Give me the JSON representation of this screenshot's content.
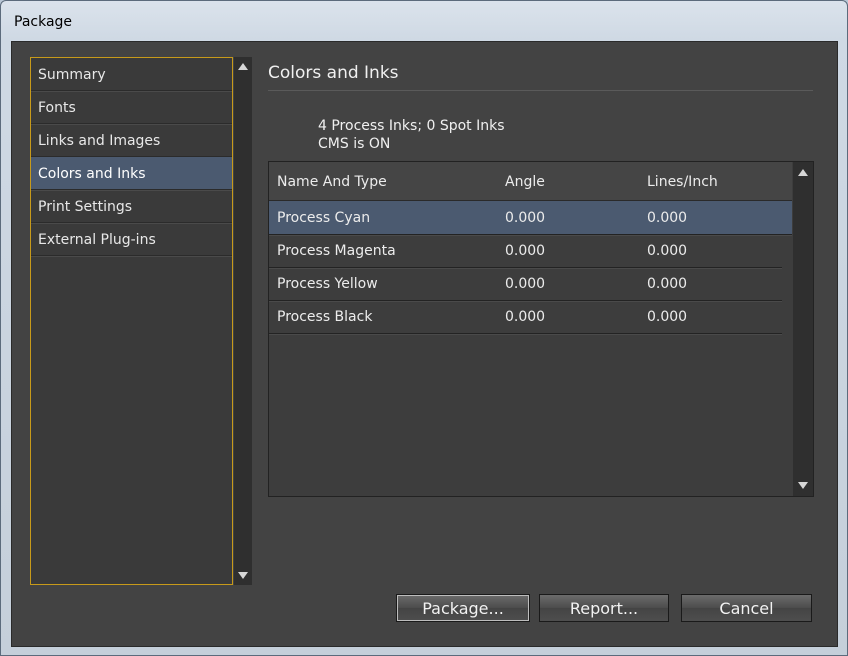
{
  "window": {
    "title": "Package"
  },
  "nav": {
    "items": [
      {
        "label": "Summary",
        "selected": false
      },
      {
        "label": "Fonts",
        "selected": false
      },
      {
        "label": "Links and Images",
        "selected": false
      },
      {
        "label": "Colors and Inks",
        "selected": true
      },
      {
        "label": "Print Settings",
        "selected": false
      },
      {
        "label": "External Plug-ins",
        "selected": false
      }
    ]
  },
  "panel": {
    "title": "Colors and Inks",
    "info_line1": "4 Process Inks; 0 Spot Inks",
    "info_line2": "CMS is ON"
  },
  "table": {
    "headers": [
      "Name And Type",
      "Angle",
      "Lines/Inch"
    ],
    "rows": [
      {
        "name": "Process Cyan",
        "angle": "0.000",
        "lpi": "0.000",
        "selected": true
      },
      {
        "name": "Process Magenta",
        "angle": "0.000",
        "lpi": "0.000",
        "selected": false
      },
      {
        "name": "Process Yellow",
        "angle": "0.000",
        "lpi": "0.000",
        "selected": false
      },
      {
        "name": "Process Black",
        "angle": "0.000",
        "lpi": "0.000",
        "selected": false
      }
    ]
  },
  "buttons": {
    "package": "Package...",
    "report": "Report...",
    "cancel": "Cancel"
  },
  "icons": [
    "scroll-up-icon",
    "scroll-down-icon"
  ],
  "colors": {
    "accent": "#c79a1a",
    "selection": "#4b5a70",
    "panel": "#434343"
  }
}
